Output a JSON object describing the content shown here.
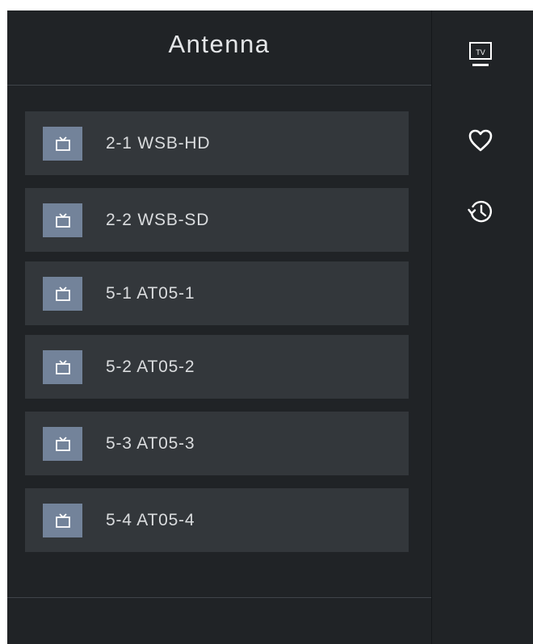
{
  "header": {
    "title": "Antenna"
  },
  "channels": [
    {
      "label": "2-1 WSB-HD",
      "icon": "tv-icon"
    },
    {
      "label": "2-2 WSB-SD",
      "icon": "tv-icon"
    },
    {
      "label": "5-1 AT05-1",
      "icon": "tv-icon"
    },
    {
      "label": "5-2 AT05-2",
      "icon": "tv-icon"
    },
    {
      "label": "5-3 AT05-3",
      "icon": "tv-icon"
    },
    {
      "label": "5-4 AT05-4",
      "icon": "tv-icon"
    }
  ],
  "side_rail": {
    "tv_icon_text": "TV",
    "items": [
      {
        "name": "tv-source",
        "icon": "tv-icon"
      },
      {
        "name": "favorites",
        "icon": "heart-icon"
      },
      {
        "name": "history",
        "icon": "history-icon"
      }
    ]
  },
  "colors": {
    "background": "#202326",
    "item_background": "#33373b",
    "icon_tile": "#73839a",
    "text": "#dadcde"
  }
}
